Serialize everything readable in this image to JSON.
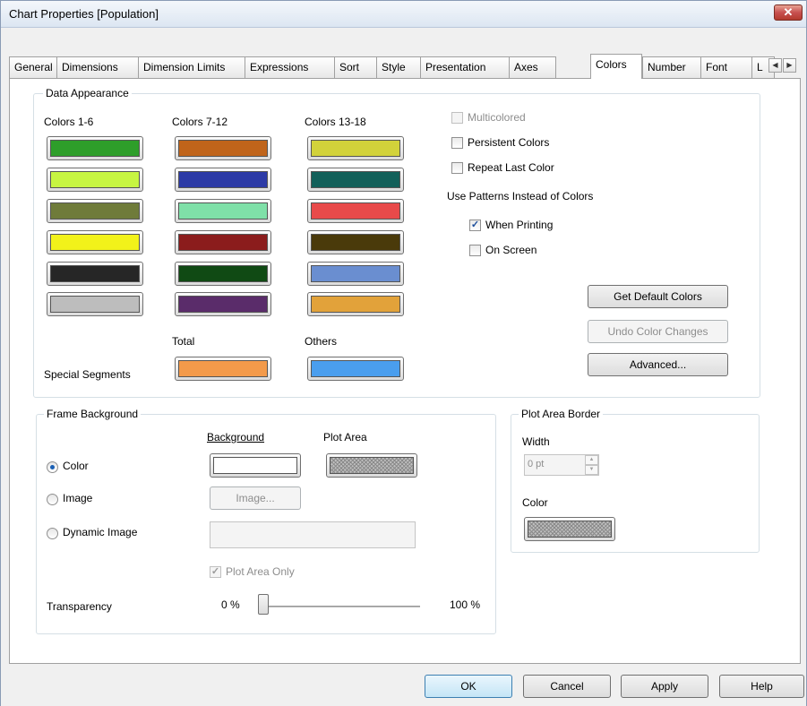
{
  "window": {
    "title": "Chart Properties [Population]",
    "close_glyph": "✕"
  },
  "tabs": [
    {
      "label": "General"
    },
    {
      "label": "Dimensions"
    },
    {
      "label": "Dimension Limits"
    },
    {
      "label": "Expressions"
    },
    {
      "label": "Sort"
    },
    {
      "label": "Style"
    },
    {
      "label": "Presentation"
    },
    {
      "label": "Axes"
    },
    {
      "label": "Colors"
    },
    {
      "label": "Number"
    },
    {
      "label": "Font"
    },
    {
      "label": "L"
    }
  ],
  "active_tab": "Colors",
  "tab_scroll": {
    "left": "◀",
    "right": "▶"
  },
  "data_appearance": {
    "legend": "Data Appearance",
    "col1_header": "Colors 1-6",
    "col2_header": "Colors 7-12",
    "col3_header": "Colors 13-18",
    "colors_1_6": [
      "#2e9e2a",
      "#c7f542",
      "#6f7b3a",
      "#f2f21a",
      "#262626",
      "#bdbdbd"
    ],
    "colors_7_12": [
      "#c0641a",
      "#2c3aa6",
      "#7fe0a8",
      "#8b1c1c",
      "#104a14",
      "#5a2c6a"
    ],
    "colors_13_18": [
      "#d2d23a",
      "#12605a",
      "#e84a4a",
      "#4a3a0a",
      "#6a8ed0",
      "#e2a23a"
    ],
    "special_segments_label": "Special Segments",
    "total_label": "Total",
    "total_color": "#f39a4a",
    "others_label": "Others",
    "others_color": "#4a9eee",
    "multicolored": {
      "label": "Multicolored",
      "checked": false,
      "disabled": true
    },
    "persistent_colors": {
      "label": "Persistent Colors",
      "checked": false
    },
    "repeat_last_color": {
      "label": "Repeat Last Color",
      "checked": false
    },
    "use_patterns_label": "Use Patterns Instead of Colors",
    "when_printing": {
      "label": "When Printing",
      "checked": true
    },
    "on_screen": {
      "label": "On Screen",
      "checked": false
    },
    "check_glyph": "✓",
    "get_default_colors": "Get Default Colors",
    "undo_color_changes": "Undo Color Changes",
    "advanced": "Advanced..."
  },
  "frame_background": {
    "legend": "Frame Background",
    "background_header": "Background",
    "plot_area_header": "Plot Area",
    "options": [
      {
        "label": "Color",
        "checked": true
      },
      {
        "label": "Image",
        "checked": false
      },
      {
        "label": "Dynamic Image",
        "checked": false
      }
    ],
    "background_color": "#ffffff",
    "image_button": "Image...",
    "dynamic_image_value": "",
    "plot_area_only": {
      "label": "Plot Area Only",
      "checked": true,
      "disabled": true
    },
    "transparency_label": "Transparency",
    "transparency_min": "0 %",
    "transparency_max": "100 %",
    "transparency_value": 0
  },
  "plot_area_border": {
    "legend": "Plot Area Border",
    "width_label": "Width",
    "width_value": "0 pt",
    "spin_up": "▲",
    "spin_down": "▼",
    "color_label": "Color"
  },
  "buttons": {
    "ok": "OK",
    "cancel": "Cancel",
    "apply": "Apply",
    "help": "Help"
  }
}
